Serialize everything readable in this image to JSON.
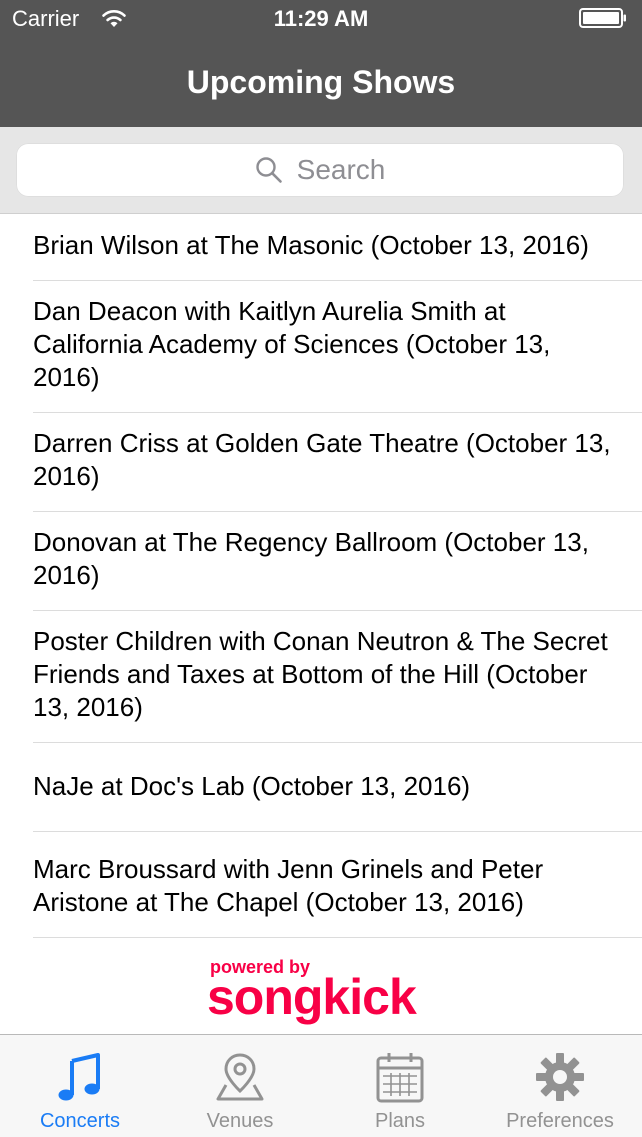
{
  "status_bar": {
    "carrier": "Carrier",
    "time": "11:29 AM"
  },
  "nav": {
    "title": "Upcoming Shows"
  },
  "search": {
    "placeholder": "Search"
  },
  "shows": [
    "Brian Wilson at The Masonic (October 13, 2016)",
    "Dan Deacon with Kaitlyn Aurelia Smith at California Academy of Sciences (October 13, 2016)",
    "Darren Criss at Golden Gate Theatre (October 13, 2016)",
    "Donovan at The Regency Ballroom (October 13, 2016)",
    "Poster Children with Conan Neutron & The Secret Friends and Taxes at Bottom of the Hill (October 13, 2016)",
    "NaJe at Doc's Lab (October 13, 2016)",
    "Marc Broussard with Jenn Grinels and Peter Aristone at The Chapel (October 13, 2016)"
  ],
  "branding": {
    "powered_by": "powered by",
    "name": "songkick"
  },
  "tabs": [
    {
      "label": "Concerts",
      "icon": "music-note-icon",
      "selected": true
    },
    {
      "label": "Venues",
      "icon": "map-pin-icon",
      "selected": false
    },
    {
      "label": "Plans",
      "icon": "calendar-icon",
      "selected": false
    },
    {
      "label": "Preferences",
      "icon": "gear-icon",
      "selected": false
    }
  ],
  "colors": {
    "nav_background": "#555555",
    "tab_active": "#1a7cf5",
    "tab_inactive": "#929292",
    "brand": "#f80046"
  }
}
